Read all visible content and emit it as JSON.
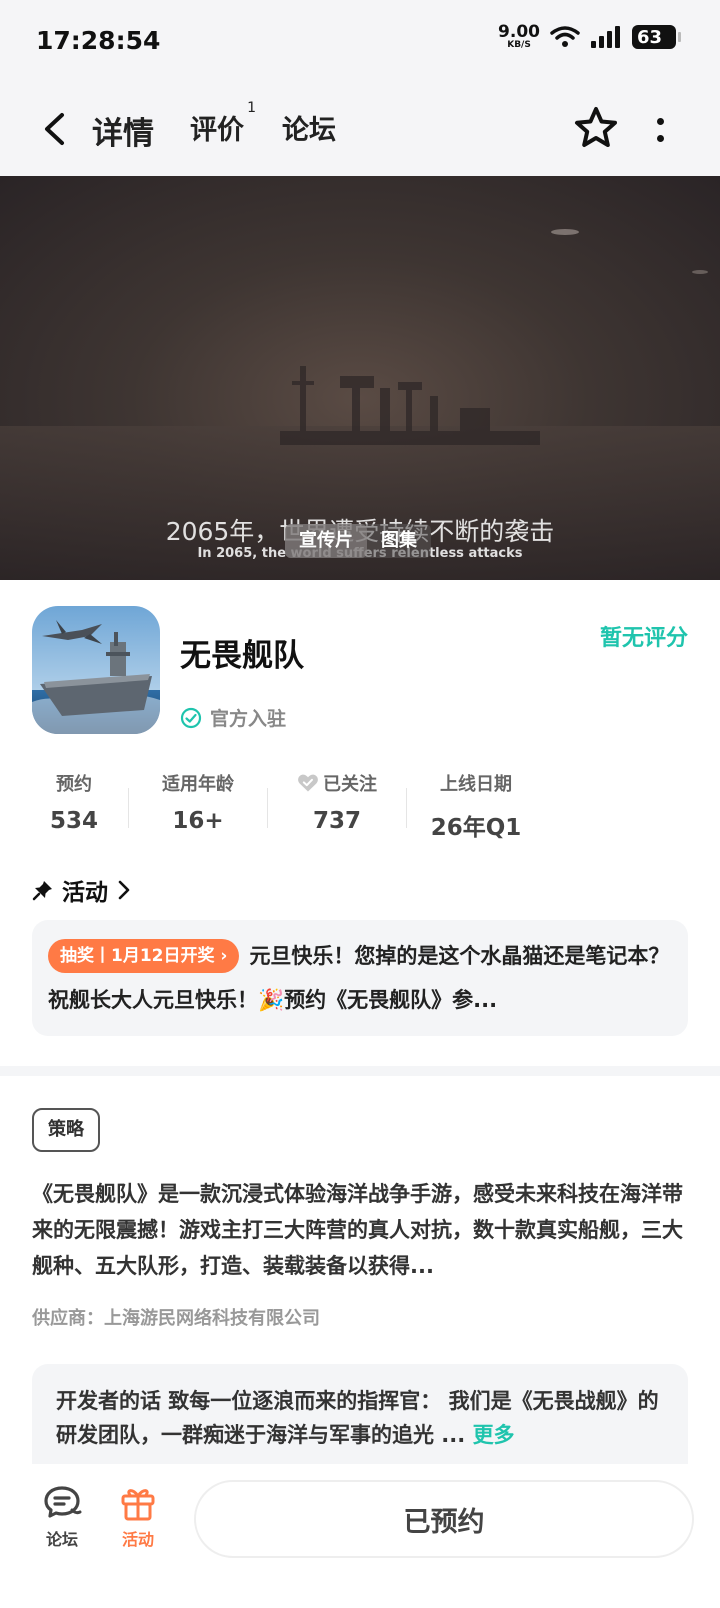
{
  "status_bar": {
    "time": "17:28:54",
    "net_speed": "9.00",
    "net_unit": "KB/S",
    "battery": "63",
    "icons": [
      "wifi-icon",
      "signal-icon",
      "battery-icon"
    ]
  },
  "nav": {
    "tabs": [
      {
        "label": "详情",
        "active": true
      },
      {
        "label": "评价",
        "badge": "1"
      },
      {
        "label": "论坛"
      }
    ],
    "icons": [
      "back-icon",
      "star-icon",
      "more-icon"
    ]
  },
  "hero": {
    "subtitle_cn": "2065年，世界遭受持续不断的袭击",
    "subtitle_en": "In 2065, the world suffers relentless attacks",
    "tabs": [
      "宣传片",
      "图集"
    ]
  },
  "app": {
    "name": "无畏舰队",
    "rating_text": "暂无评分",
    "official_label": "官方入驻"
  },
  "stats": [
    {
      "label": "预约",
      "value": "534"
    },
    {
      "label": "适用年龄",
      "value": "16+"
    },
    {
      "label": "已关注",
      "value": "737"
    },
    {
      "label": "上线日期",
      "value": "26年Q1"
    }
  ],
  "activity": {
    "title": "活动",
    "tag": "抽奖丨1月12日开奖",
    "text": "元旦快乐！您掉的是这个水晶猫还是笔记本？ 祝舰长大人元旦快乐！🎉预约《无畏舰队》参..."
  },
  "description": {
    "tag": "策略",
    "text": "《无畏舰队》是一款沉浸式体验海洋战争手游，感受未来科技在海洋带来的无限震撼！游戏主打三大阵营的真人对抗，数十款真实船舰，三大舰种、五大队形，打造、装载装备以获得...",
    "supplier": "供应商：上海游民网络科技有限公司"
  },
  "developer": {
    "text": "开发者的话  致每一位逐浪而来的指挥官： 我们是《无畏战舰》的研发团队，一群痴迷于海洋与军事的追光 ...",
    "more_label": "更多"
  },
  "bottom_bar": {
    "forum_label": "论坛",
    "activity_label": "活动",
    "reserve_label": "已预约"
  },
  "colors": {
    "accent": "#1fc4ad",
    "orange": "#ff7a45"
  }
}
